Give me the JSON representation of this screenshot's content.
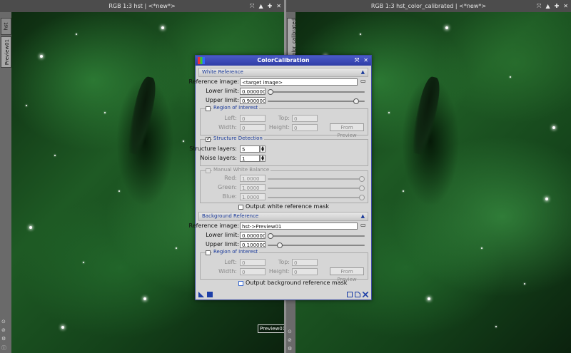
{
  "left_window": {
    "title": "RGB 1:3 hst | <*new*>",
    "tabs": [
      "hst",
      "Preview01"
    ],
    "preview_label": "Preview01"
  },
  "right_window": {
    "title": "RGB 1:3 hst_color_calibrated | <*new*>",
    "tabs": [
      "hst_color_calibrated"
    ]
  },
  "window_buttons": [
    "⤧",
    "▲",
    "✚",
    "✕"
  ],
  "dialog": {
    "title": "ColorCalibration",
    "title_buttons": [
      "⤧",
      "✕"
    ],
    "white_reference": {
      "header": "White Reference",
      "reference_image_label": "Reference image:",
      "reference_image_value": "<target image>",
      "lower_limit_label": "Lower limit:",
      "lower_limit_value": "0.0000000",
      "lower_limit_fraction": 0.0,
      "upper_limit_label": "Upper limit:",
      "upper_limit_value": "0.9000000",
      "upper_limit_fraction": 0.9,
      "roi": {
        "title": "Region of Interest",
        "left_label": "Left:",
        "left_value": "0",
        "top_label": "Top:",
        "top_value": "0",
        "width_label": "Width:",
        "width_value": "0",
        "height_label": "Height:",
        "height_value": "0",
        "from_preview": "From Preview"
      },
      "structure_detection": {
        "title": "Structure Detection",
        "checked": true,
        "structure_layers_label": "Structure layers:",
        "structure_layers_value": "5",
        "noise_layers_label": "Noise layers:",
        "noise_layers_value": "1"
      },
      "manual_wb": {
        "title": "Manual White Balance",
        "red_label": "Red:",
        "red_value": "1.0000",
        "green_label": "Green:",
        "green_value": "1.0000",
        "blue_label": "Blue:",
        "blue_value": "1.0000"
      },
      "output_mask": "Output white reference mask"
    },
    "background_reference": {
      "header": "Background Reference",
      "reference_image_label": "Reference image:",
      "reference_image_value": "hst->Preview01",
      "lower_limit_label": "Lower limit:",
      "lower_limit_value": "0.0000000",
      "lower_limit_fraction": 0.0,
      "upper_limit_label": "Upper limit:",
      "upper_limit_value": "0.1000000",
      "upper_limit_fraction": 0.1,
      "roi": {
        "title": "Region of Interest",
        "left_label": "Left:",
        "left_value": "0",
        "top_label": "Top:",
        "top_value": "0",
        "width_label": "Width:",
        "width_value": "0",
        "height_label": "Height:",
        "height_value": "0",
        "from_preview": "From Preview"
      },
      "output_mask": "Output background reference mask"
    },
    "collapse_icon": "▲"
  },
  "colors": {
    "dialog_title": "#2f3da6",
    "section_text": "#1a3a9a",
    "nebula": "#1e5a24"
  }
}
